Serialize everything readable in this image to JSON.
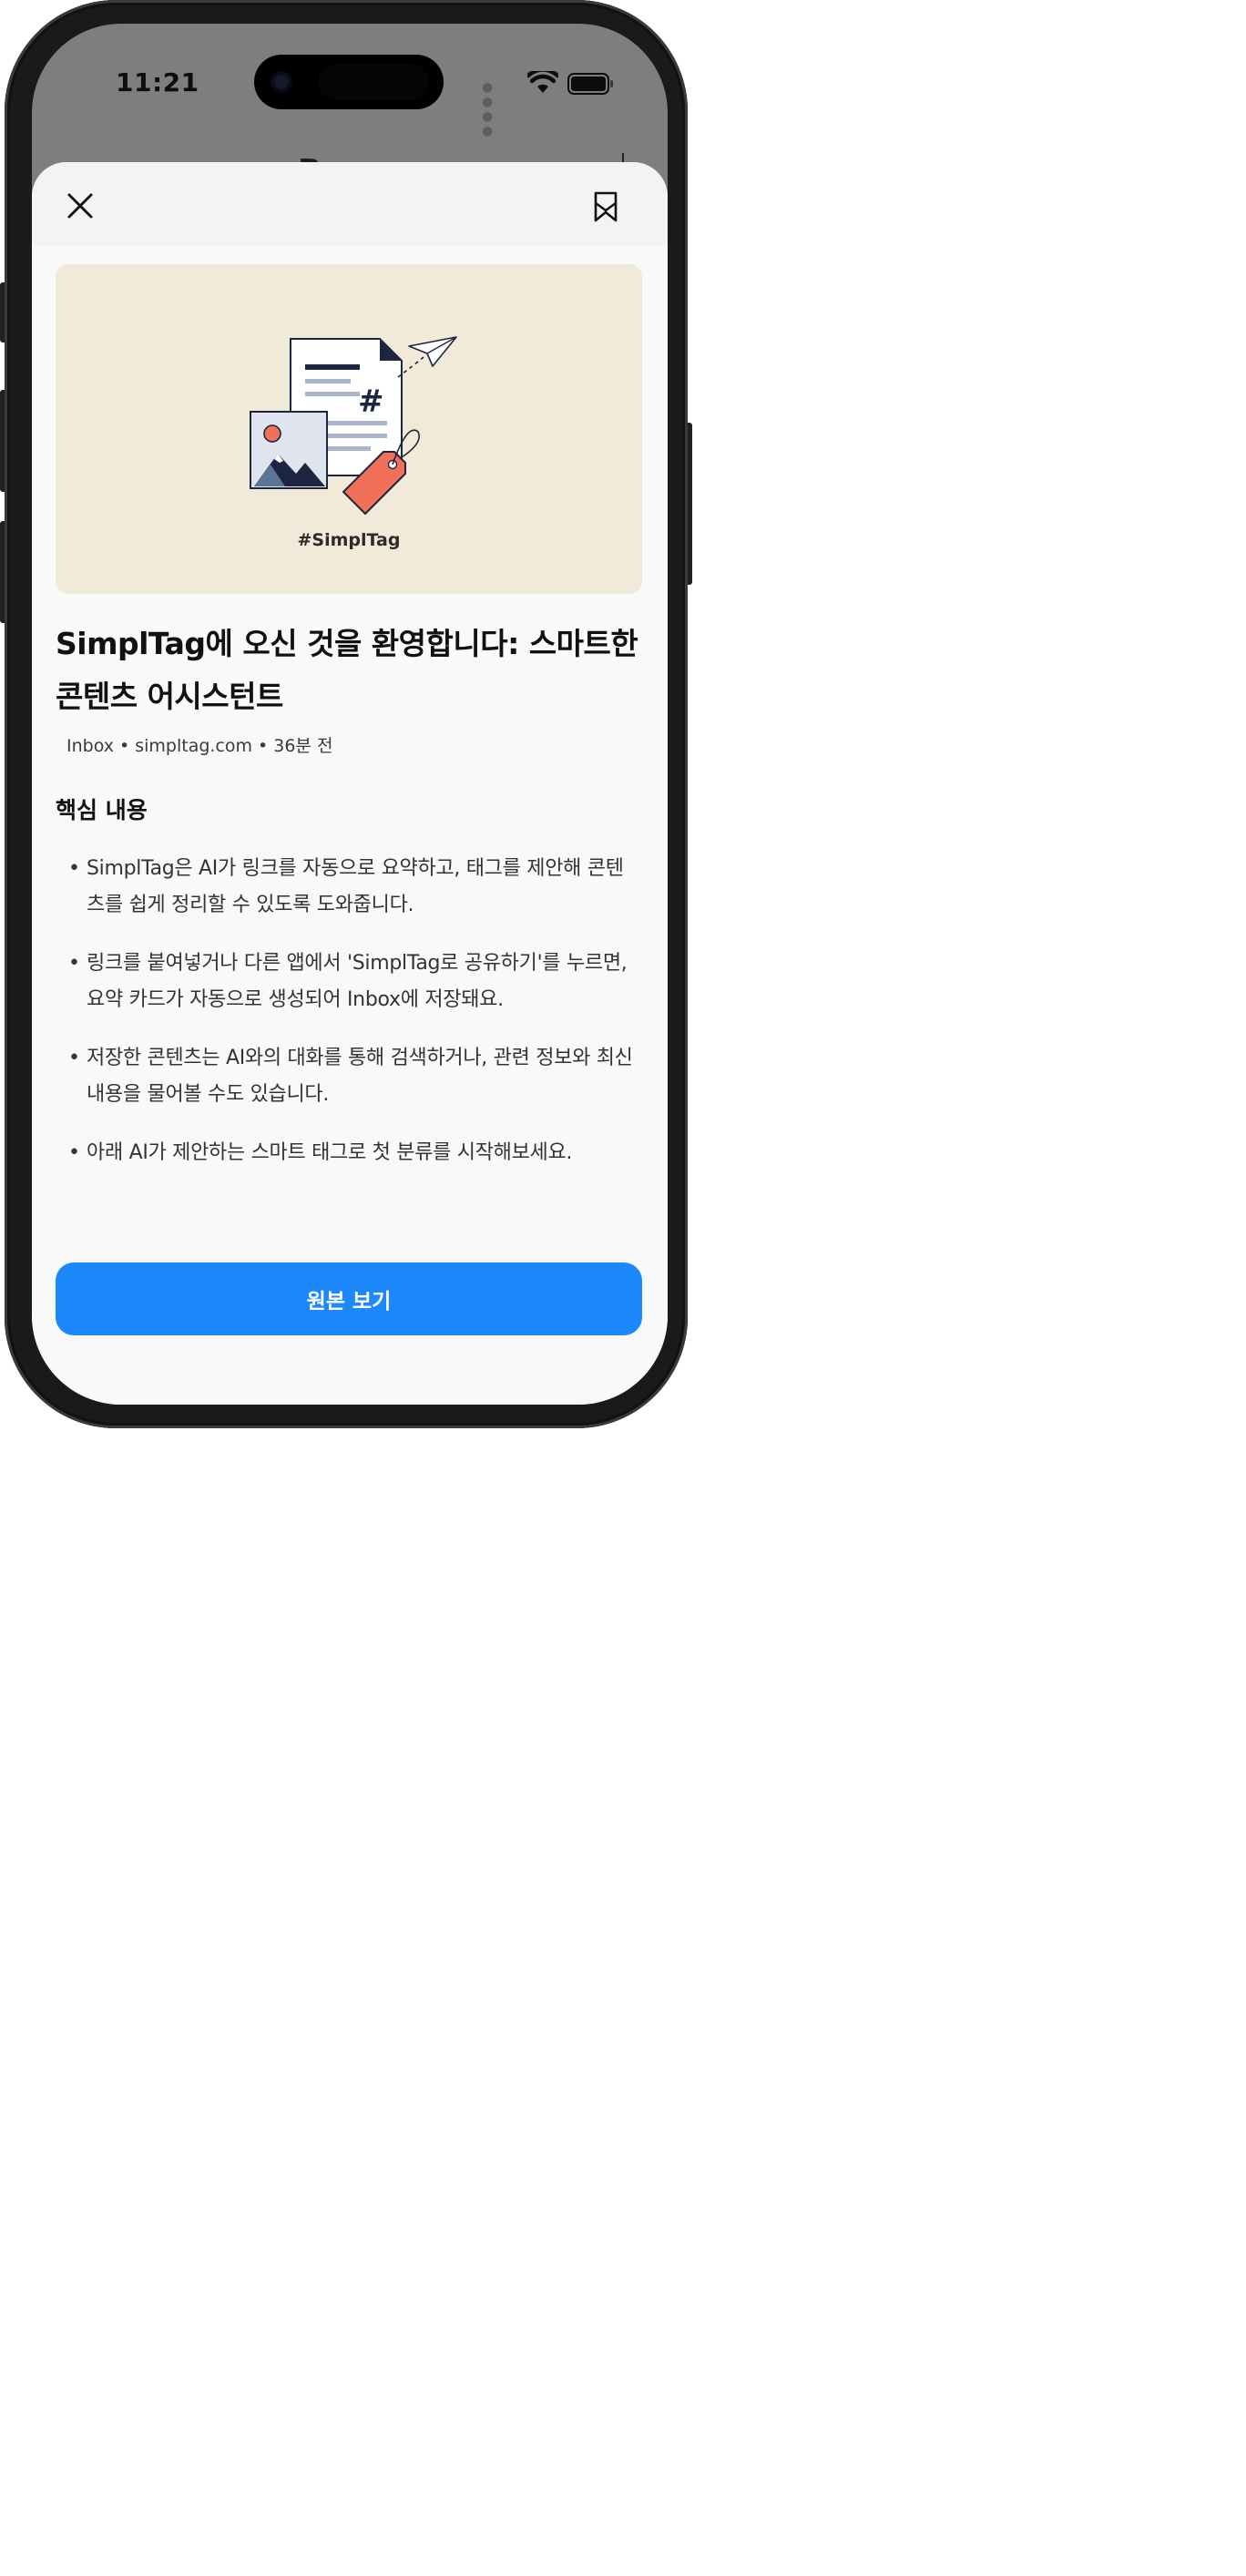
{
  "status_bar": {
    "time": "11:21"
  },
  "background_app": {
    "title_peek": "Bxx...:"
  },
  "header": {
    "close_icon": "close-icon",
    "bookmark_icon": "bookmark-icon"
  },
  "hero": {
    "caption": "#SimplTag"
  },
  "article": {
    "title": "SimplTag에 오신 것을 환영합니다: 스마트한 콘텐츠 어시스턴트",
    "source": "Inbox",
    "domain": "simpltag.com",
    "time_ago": "36분 전",
    "meta_separator": "•"
  },
  "summary": {
    "heading": "핵심 내용",
    "bullet_glyph": "•",
    "bullets": [
      "SimplTag은 AI가 링크를 자동으로 요약하고, 태그를 제안해 콘텐츠를 쉽게 정리할 수 있도록 도와줍니다.",
      "링크를 붙여넣거나 다른 앱에서 'SimplTag로 공유하기'를 누르면, 요약 카드가 자동으로 생성되어 Inbox에 저장돼요.",
      "저장한 콘텐츠는 AI와의 대화를 통해 검색하거나, 관련 정보와 최신 내용을 물어볼 수도 있습니다.",
      "아래 AI가 제안하는 스마트 태그로 첫 분류를 시작해보세요."
    ]
  },
  "footer": {
    "open_original_label": "원본 보기"
  },
  "colors": {
    "accent": "#1C88FB",
    "hero_bg": "#F2EAD9",
    "tag_orange": "#F0705A",
    "navy": "#1E2540"
  }
}
